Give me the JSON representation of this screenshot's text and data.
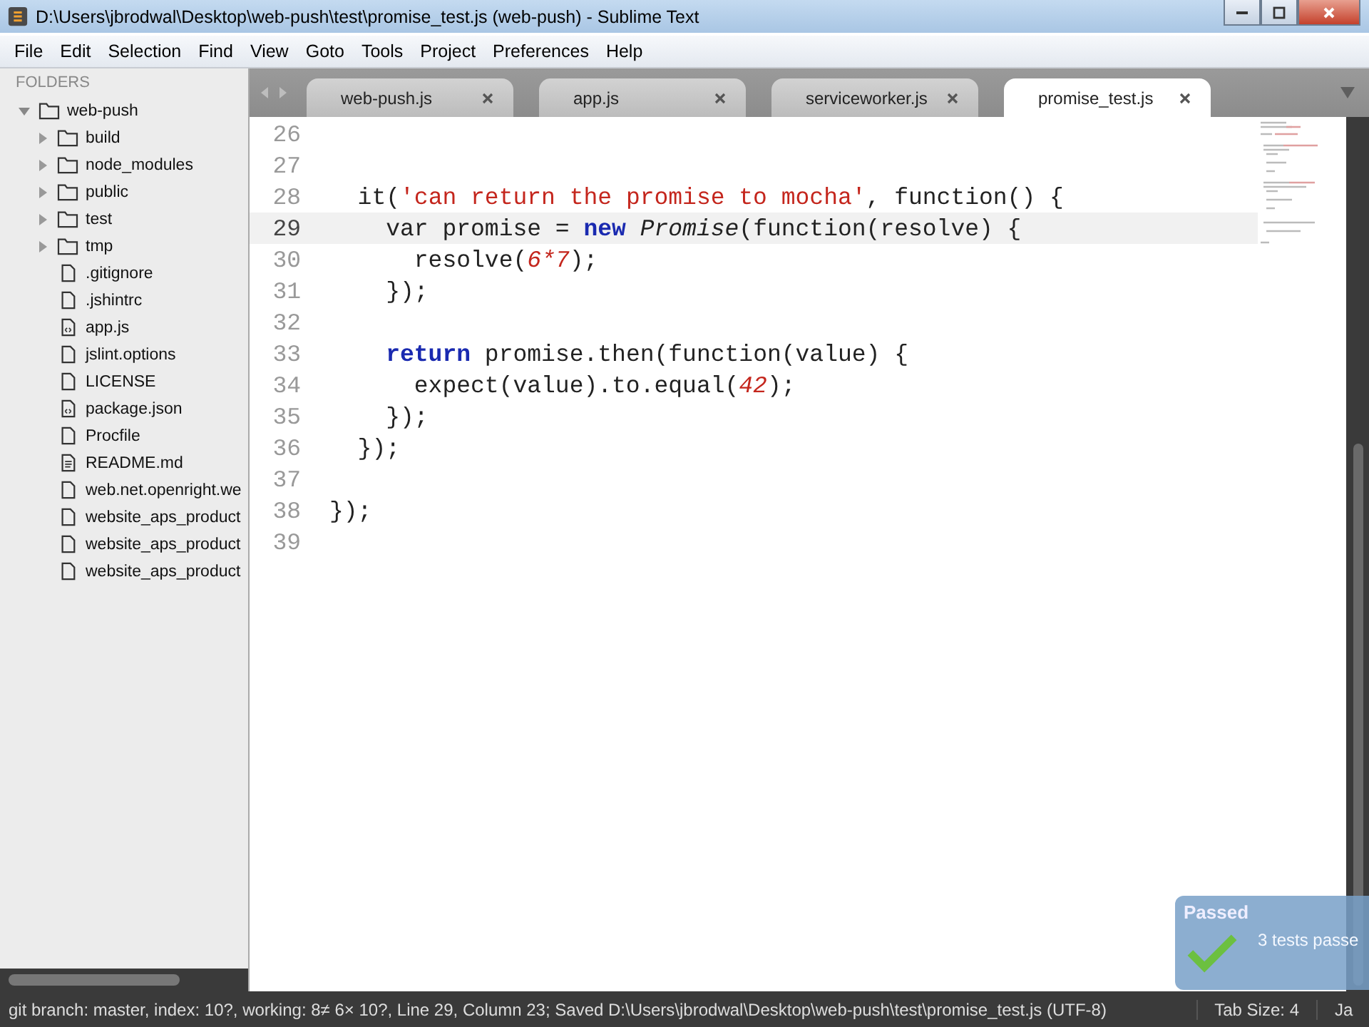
{
  "window": {
    "title": "D:\\Users\\jbrodwal\\Desktop\\web-push\\test\\promise_test.js (web-push) - Sublime Text"
  },
  "menu": [
    "File",
    "Edit",
    "Selection",
    "Find",
    "View",
    "Goto",
    "Tools",
    "Project",
    "Preferences",
    "Help"
  ],
  "sidebar": {
    "header": "FOLDERS",
    "tree": {
      "name": "web-push",
      "expanded": true,
      "children": [
        {
          "name": "build",
          "kind": "folder",
          "expanded": false
        },
        {
          "name": "node_modules",
          "kind": "folder",
          "expanded": false
        },
        {
          "name": "public",
          "kind": "folder",
          "expanded": false
        },
        {
          "name": "test",
          "kind": "folder",
          "expanded": false
        },
        {
          "name": "tmp",
          "kind": "folder",
          "expanded": false
        },
        {
          "name": ".gitignore",
          "kind": "file"
        },
        {
          "name": ".jshintrc",
          "kind": "file"
        },
        {
          "name": "app.js",
          "kind": "code-file"
        },
        {
          "name": "jslint.options",
          "kind": "file"
        },
        {
          "name": "LICENSE",
          "kind": "file"
        },
        {
          "name": "package.json",
          "kind": "code-file"
        },
        {
          "name": "Procfile",
          "kind": "file"
        },
        {
          "name": "README.md",
          "kind": "text-file"
        },
        {
          "name": "web.net.openright.we",
          "kind": "file"
        },
        {
          "name": "website_aps_product",
          "kind": "file"
        },
        {
          "name": "website_aps_product",
          "kind": "file"
        },
        {
          "name": "website_aps_product",
          "kind": "file"
        }
      ]
    }
  },
  "tabs": [
    {
      "label": "web-push.js",
      "selected": false
    },
    {
      "label": "app.js",
      "selected": false
    },
    {
      "label": "serviceworker.js",
      "selected": false
    },
    {
      "label": "promise_test.js",
      "selected": true
    }
  ],
  "editor": {
    "lines": [
      {
        "number": "26",
        "current": false
      },
      {
        "number": "27",
        "current": false
      },
      {
        "number": "28",
        "current": false,
        "tokens": [
          {
            "kind": "plain",
            "text": "  it("
          },
          {
            "kind": "string",
            "text": "'can return the promise to mocha'"
          },
          {
            "kind": "plain",
            "text": ", function() {"
          }
        ]
      },
      {
        "number": "29",
        "current": true,
        "tokens": [
          {
            "kind": "plain",
            "text": "    var promise = "
          },
          {
            "kind": "keyword",
            "text": "new"
          },
          {
            "kind": "class",
            "text": " Promise"
          },
          {
            "kind": "plain",
            "text": "(function(resolve) {"
          }
        ]
      },
      {
        "number": "30",
        "current": false,
        "tokens": [
          {
            "kind": "plain",
            "text": "      resolve("
          },
          {
            "kind": "number",
            "text": "6*7"
          },
          {
            "kind": "plain",
            "text": ");"
          }
        ]
      },
      {
        "number": "31",
        "current": false,
        "tokens": [
          {
            "kind": "plain",
            "text": "    });"
          }
        ]
      },
      {
        "number": "32",
        "current": false
      },
      {
        "number": "33",
        "current": false,
        "tokens": [
          {
            "kind": "keyword",
            "text": "    return"
          },
          {
            "kind": "plain",
            "text": " promise.then(function(value) {"
          }
        ]
      },
      {
        "number": "34",
        "current": false,
        "tokens": [
          {
            "kind": "plain",
            "text": "      expect(value).to.equal("
          },
          {
            "kind": "number",
            "text": "42"
          },
          {
            "kind": "plain",
            "text": ");"
          }
        ]
      },
      {
        "number": "35",
        "current": false,
        "tokens": [
          {
            "kind": "plain",
            "text": "    });"
          }
        ]
      },
      {
        "number": "36",
        "current": false,
        "tokens": [
          {
            "kind": "plain",
            "text": "  });"
          }
        ]
      },
      {
        "number": "37",
        "current": false
      },
      {
        "number": "38",
        "current": false,
        "tokens": [
          {
            "kind": "plain",
            "text": "});"
          }
        ]
      },
      {
        "number": "39",
        "current": false
      }
    ]
  },
  "status_bar": {
    "text": "git branch: master, index: 10?, working: 8≠ 6× 10?, Line 29, Column 23; Saved D:\\Users\\jbrodwal\\Desktop\\web-push\\test\\promise_test.js (UTF-8)",
    "tab_size": "Tab Size: 4",
    "syntax": "Ja"
  },
  "notification": {
    "title": "Passed",
    "message": "3 tests passe"
  }
}
